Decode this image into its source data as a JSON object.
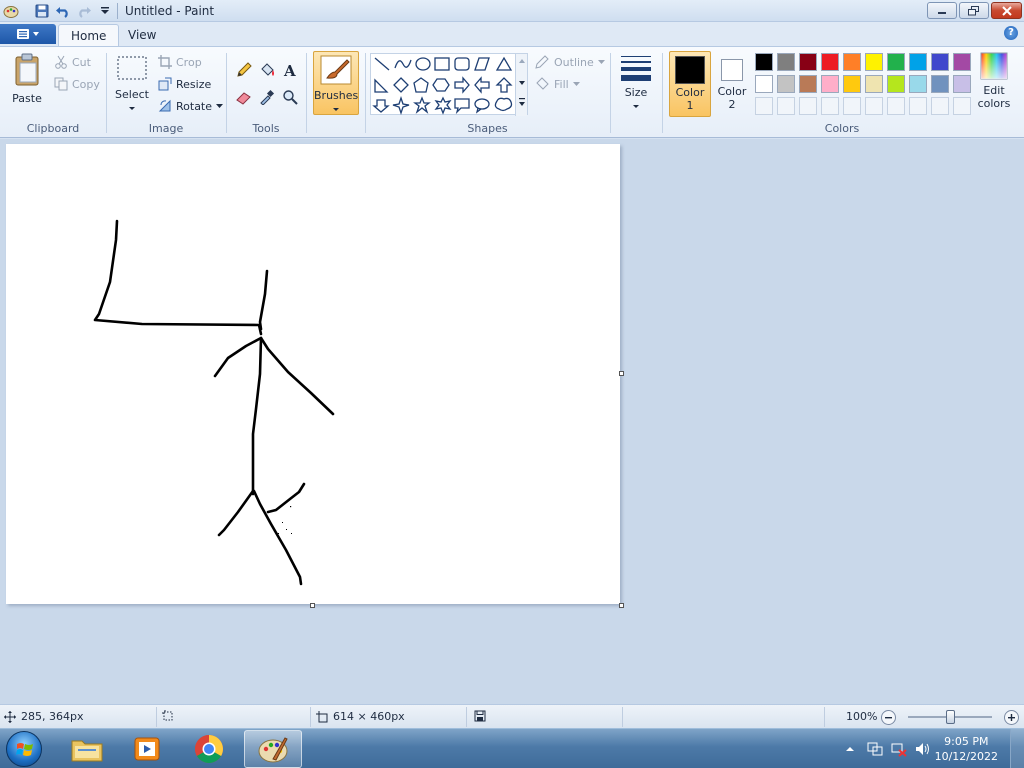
{
  "window": {
    "title": "Untitled - Paint"
  },
  "tabs": [
    {
      "label": "Home",
      "active": true
    },
    {
      "label": "View",
      "active": false
    }
  ],
  "clipboard": {
    "paste": "Paste",
    "cut": "Cut",
    "copy": "Copy",
    "group": "Clipboard"
  },
  "image": {
    "select": "Select",
    "crop": "Crop",
    "resize": "Resize",
    "rotate": "Rotate",
    "group": "Image"
  },
  "tools": {
    "group": "Tools"
  },
  "brushes": {
    "label": "Brushes"
  },
  "shapes": {
    "outline": "Outline",
    "fill": "Fill",
    "group": "Shapes"
  },
  "size": {
    "label": "Size"
  },
  "colors": {
    "color1_label": "Color",
    "color1_num": "1",
    "color2_label": "Color",
    "color2_num": "2",
    "edit_label": "Edit",
    "edit_label2": "colors",
    "group": "Colors",
    "color1": "#000000",
    "color2": "#ffffff",
    "palette_row1": [
      "#000000",
      "#7f7f7f",
      "#880015",
      "#ed1c24",
      "#ff7f27",
      "#fff200",
      "#22b14c",
      "#00a2e8",
      "#3f48cc",
      "#a349a4"
    ],
    "palette_row2": [
      "#ffffff",
      "#c3c3c3",
      "#b97a57",
      "#ffaec9",
      "#ffc90e",
      "#efe4b0",
      "#b5e61d",
      "#99d9ea",
      "#7092be",
      "#c8bfe7"
    ]
  },
  "status": {
    "cursor_pos": "285, 364px",
    "image_size": "614 × 460px",
    "zoom": "100%"
  },
  "taskbar": {
    "time": "9:05 PM",
    "date": "10/12/2022"
  }
}
